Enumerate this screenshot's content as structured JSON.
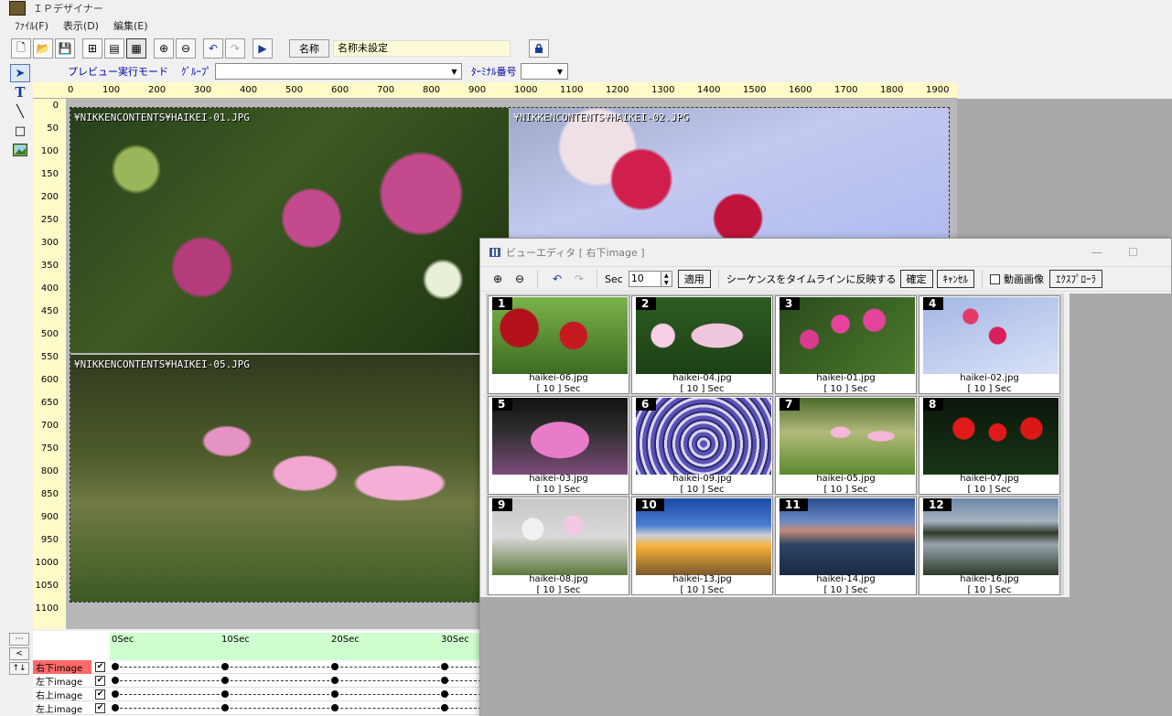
{
  "window": {
    "title": "ＩＰデザイナー"
  },
  "menu": [
    "ﾌｧｲﾙ(F)",
    "表示(D)",
    "編集(E)"
  ],
  "toolbar": {
    "name_label": "名称",
    "name_value": "名称未設定"
  },
  "preview": {
    "mode_label": "プレビュー実行モード",
    "group_label": "ｸﾞﾙｰﾌﾟ",
    "terminal_label": "ﾀｰﾐﾅﾙ番号",
    "group_value": "",
    "terminal_value": ""
  },
  "ruler": {
    "h": [
      "0",
      "100",
      "200",
      "300",
      "400",
      "500",
      "600",
      "700",
      "800",
      "900",
      "1000",
      "1100",
      "1200",
      "1300",
      "1400",
      "1500",
      "1600",
      "1700",
      "1800",
      "1900"
    ],
    "v": [
      "0",
      "50",
      "100",
      "150",
      "200",
      "250",
      "300",
      "350",
      "400",
      "450",
      "500",
      "550",
      "600",
      "650",
      "700",
      "750",
      "800",
      "850",
      "900",
      "950",
      "1000",
      "1050",
      "1100"
    ]
  },
  "canvas": {
    "images": [
      {
        "label": "¥NIKKENCONTENTS¥HAIKEI-01.JPG"
      },
      {
        "label": "¥NIKKENCONTENTS¥HAIKEI-02.JPG"
      },
      {
        "label": "¥NIKKENCONTENTS¥HAIKEI-05.JPG"
      }
    ]
  },
  "timeline": {
    "times": [
      "0Sec",
      "10Sec",
      "20Sec",
      "30Sec"
    ],
    "tracks": [
      {
        "name": "右下image",
        "checked": "✔"
      },
      {
        "name": "左下image",
        "checked": "✔"
      },
      {
        "name": "右上image",
        "checked": "✔"
      },
      {
        "name": "左上image",
        "checked": "✔"
      }
    ],
    "buttons": [
      "⋯",
      "<",
      "↑↓"
    ]
  },
  "viewer": {
    "title": "ビューエディタ [ 右下image ]",
    "sec_label": "Sec",
    "sec_value": "10",
    "apply": "適用",
    "seq_label": "シーケンスをタイムラインに反映する",
    "confirm": "確定",
    "cancel": "ｷｬﾝｾﾙ",
    "movie_label": "動画画像",
    "explorer": "ｴｸｽﾌﾟﾛｰﾗ",
    "items": [
      {
        "num": "1",
        "file": "haikei-06.jpg",
        "sec": "[ 10 ] Sec"
      },
      {
        "num": "2",
        "file": "haikei-04.jpg",
        "sec": "[ 10 ] Sec"
      },
      {
        "num": "3",
        "file": "haikei-01.jpg",
        "sec": "[ 10 ] Sec"
      },
      {
        "num": "4",
        "file": "haikei-02.jpg",
        "sec": "[ 10 ] Sec"
      },
      {
        "num": "5",
        "file": "haikei-03.jpg",
        "sec": "[ 10 ] Sec"
      },
      {
        "num": "6",
        "file": "haikei-09.jpg",
        "sec": "[ 10 ] Sec"
      },
      {
        "num": "7",
        "file": "haikei-05.jpg",
        "sec": "[ 10 ] Sec"
      },
      {
        "num": "8",
        "file": "haikei-07.jpg",
        "sec": "[ 10 ] Sec"
      },
      {
        "num": "9",
        "file": "haikei-08.jpg",
        "sec": "[ 10 ] Sec"
      },
      {
        "num": "10",
        "file": "haikei-13.jpg",
        "sec": "[ 10 ] Sec"
      },
      {
        "num": "11",
        "file": "haikei-14.jpg",
        "sec": "[ 10 ] Sec"
      },
      {
        "num": "12",
        "file": "haikei-16.jpg",
        "sec": "[ 10 ] Sec"
      }
    ]
  }
}
